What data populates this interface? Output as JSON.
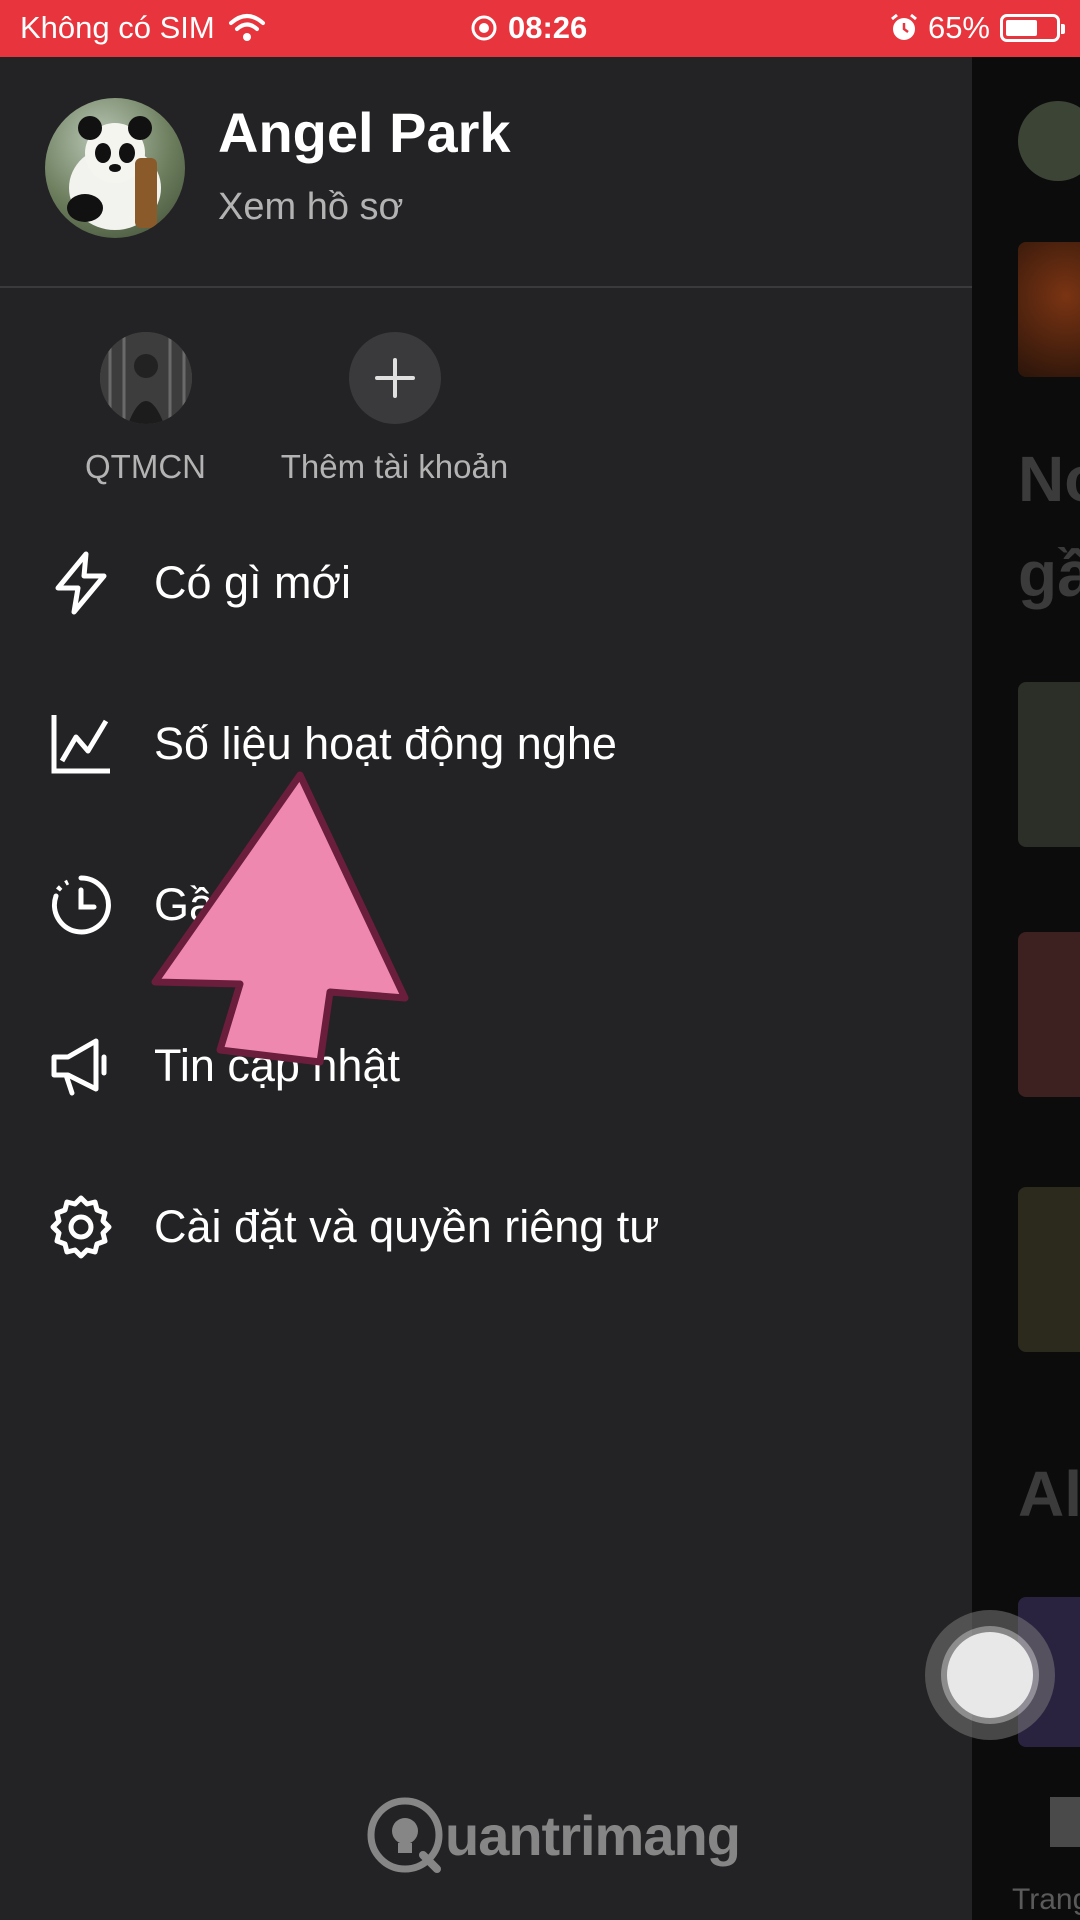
{
  "status_bar": {
    "carrier": "Không có SIM",
    "time": "08:26",
    "battery_percent": "65%",
    "battery_level": 0.65
  },
  "profile": {
    "name": "Angel Park",
    "view_profile": "Xem hồ sơ"
  },
  "accounts": [
    {
      "label": "QTMCN",
      "icon": "user-avatar"
    },
    {
      "label": "Thêm tài khoản",
      "icon": "plus-icon"
    }
  ],
  "menu": [
    {
      "label": "Có gì mới",
      "icon": "lightning-icon"
    },
    {
      "label": "Số liệu hoạt động nghe",
      "icon": "chart-icon"
    },
    {
      "label": "Gần đây",
      "icon": "history-icon"
    },
    {
      "label": "Tin cập nhật",
      "icon": "megaphone-icon"
    },
    {
      "label": "Cài đặt và quyền riêng tư",
      "icon": "gear-icon"
    }
  ],
  "background_peek": {
    "text_1": "No",
    "text_2": "gầ",
    "text_3": "Al",
    "nav_label": "Trang"
  },
  "watermark": "uantrimang",
  "colors": {
    "status_bar": "#e8343c",
    "drawer_bg": "#232224",
    "arrow_fill": "#ef88ae",
    "arrow_stroke": "#6b1d3c"
  }
}
